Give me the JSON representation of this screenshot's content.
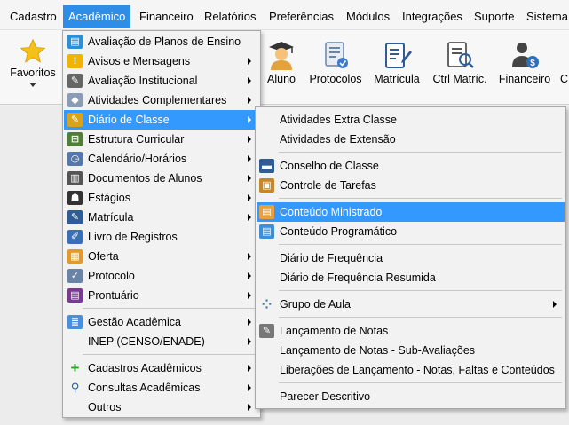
{
  "menubar": {
    "items": [
      {
        "label": "Cadastro"
      },
      {
        "label": "Acadêmico"
      },
      {
        "label": "Financeiro"
      },
      {
        "label": "Relatórios"
      },
      {
        "label": "Preferências"
      },
      {
        "label": "Módulos"
      },
      {
        "label": "Integrações"
      },
      {
        "label": "Suporte"
      },
      {
        "label": "Sistema"
      }
    ],
    "active": "Acadêmico"
  },
  "ribbon": {
    "favoritos": "Favoritos",
    "buttons": [
      {
        "label": "Aluno",
        "icon": "student-icon"
      },
      {
        "label": "Protocolos",
        "icon": "protocol-icon"
      },
      {
        "label": "Matrícula",
        "icon": "enrollment-icon"
      },
      {
        "label": "Ctrl Matríc.",
        "icon": "enrollment-control-icon"
      },
      {
        "label": "Financeiro",
        "icon": "finance-icon"
      },
      {
        "label": "C",
        "icon": "truncated-icon"
      }
    ]
  },
  "academic_menu": {
    "items": [
      {
        "label": "Avaliação de Planos de Ensino",
        "icon": "teaching-plan-icon",
        "submenu": false
      },
      {
        "label": "Avisos e Mensagens",
        "icon": "warning-icon",
        "submenu": true
      },
      {
        "label": "Avaliação Institucional",
        "icon": "evaluation-icon",
        "submenu": true
      },
      {
        "label": "Atividades Complementares",
        "icon": "activities-icon",
        "submenu": true
      },
      {
        "label": "Diário de Classe",
        "icon": "class-diary-icon",
        "submenu": true,
        "highlighted": true
      },
      {
        "label": "Estrutura Curricular",
        "icon": "curriculum-icon",
        "submenu": true
      },
      {
        "label": "Calendário/Horários",
        "icon": "calendar-clock-icon",
        "submenu": true
      },
      {
        "label": "Documentos de Alunos",
        "icon": "documents-icon",
        "submenu": true
      },
      {
        "label": "Estágios",
        "icon": "internship-icon",
        "submenu": true
      },
      {
        "label": "Matrícula",
        "icon": "enrollment-icon",
        "submenu": true
      },
      {
        "label": "Livro de Registros",
        "icon": "record-book-icon",
        "submenu": false
      },
      {
        "label": "Oferta",
        "icon": "offer-calendar-icon",
        "submenu": true
      },
      {
        "label": "Protocolo",
        "icon": "protocol-icon",
        "submenu": true
      },
      {
        "label": "Prontuário",
        "icon": "record-icon",
        "submenu": true
      },
      {
        "label": "Gestão Acadêmica",
        "icon": "management-icon",
        "submenu": true
      },
      {
        "label": "INEP (CENSO/ENADE)",
        "icon": "",
        "submenu": true
      },
      {
        "label": "Cadastros Acadêmicos",
        "icon": "add-icon",
        "submenu": true
      },
      {
        "label": "Consultas Acadêmicas",
        "icon": "search-icon",
        "submenu": true
      },
      {
        "label": "Outros",
        "icon": "",
        "submenu": true
      }
    ]
  },
  "diary_submenu": {
    "items": [
      {
        "label": "Atividades Extra Classe",
        "icon": ""
      },
      {
        "label": "Atividades de Extensão",
        "icon": ""
      },
      {
        "label": "Conselho de Classe",
        "icon": "class-council-icon"
      },
      {
        "label": "Controle de Tarefas",
        "icon": "task-control-icon"
      },
      {
        "label": "Conteúdo Ministrado",
        "icon": "content-taught-icon",
        "highlighted": true
      },
      {
        "label": "Conteúdo Programático",
        "icon": "syllabus-icon"
      },
      {
        "label": "Diário de Frequência",
        "icon": ""
      },
      {
        "label": "Diário de Frequência Resumida",
        "icon": ""
      },
      {
        "label": "Grupo de Aula",
        "icon": "class-group-icon",
        "submenu": true
      },
      {
        "label": "Lançamento de Notas",
        "icon": "grades-icon"
      },
      {
        "label": "Lançamento de Notas - Sub-Avaliações",
        "icon": ""
      },
      {
        "label": "Liberações de Lançamento - Notas, Faltas e Conteúdos",
        "icon": ""
      },
      {
        "label": "Parecer Descritivo",
        "icon": ""
      }
    ]
  },
  "colors": {
    "menu_highlight": "#3399ff",
    "menubar_active": "#2e8ee7"
  }
}
